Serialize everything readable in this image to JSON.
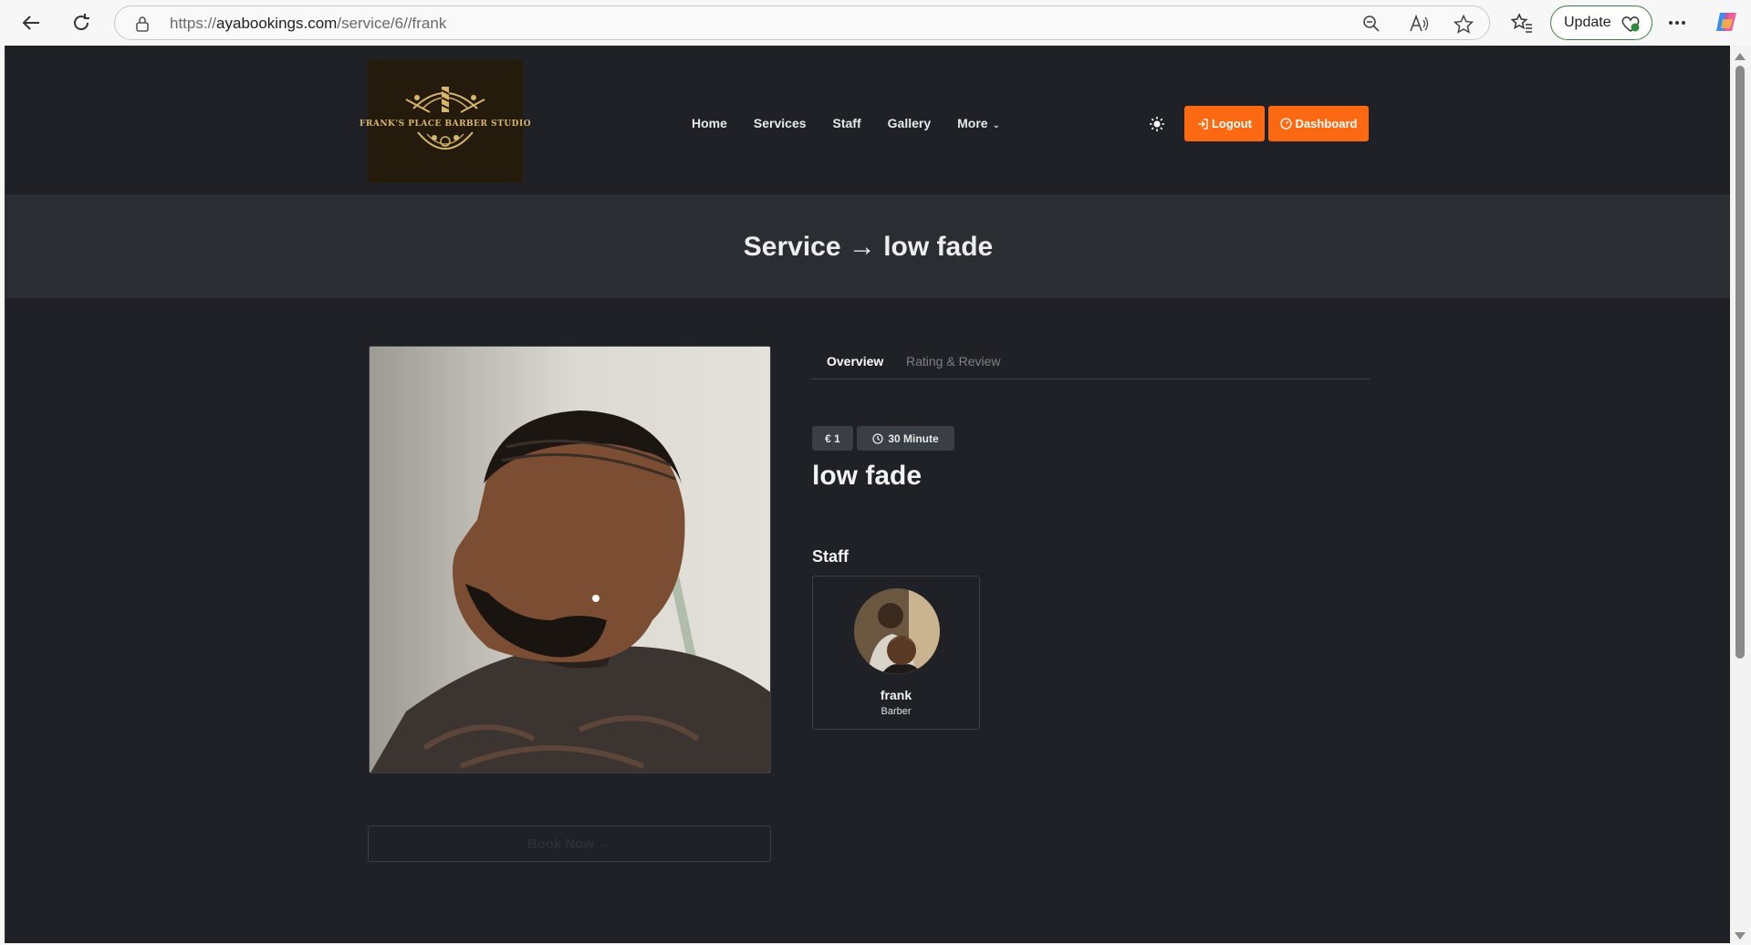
{
  "browser": {
    "url_prefix": "https://",
    "url_host": "ayabookings.com",
    "url_path": "/service/6//frank",
    "update_label": "Update"
  },
  "site": {
    "logo_text": "FRANK'S PLACE BARBER STUDIO",
    "nav": {
      "home": "Home",
      "services": "Services",
      "staff": "Staff",
      "gallery": "Gallery",
      "more": "More"
    },
    "logout_label": "Logout",
    "dashboard_label": "Dashboard",
    "accent_color": "#fb6a12"
  },
  "banner": {
    "title": "Service → low fade"
  },
  "service": {
    "tabs": {
      "overview": "Overview",
      "rating": "Rating & Review"
    },
    "price": "€ 1",
    "duration": "30 Minute",
    "name": "low fade",
    "book_label": "Book Now →",
    "staff_heading": "Staff",
    "staff": [
      {
        "name": "frank",
        "role": "Barber"
      }
    ]
  }
}
